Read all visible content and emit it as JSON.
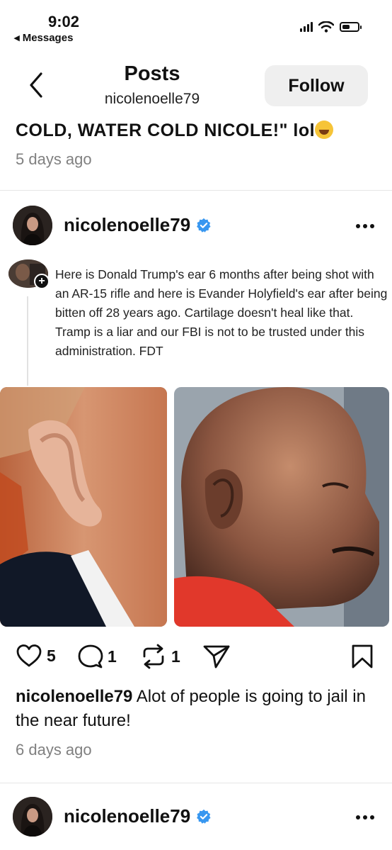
{
  "status_bar": {
    "time": "9:02",
    "back_app": "◂ Messages"
  },
  "header": {
    "title": "Posts",
    "subtitle": "nicolenoelle79",
    "follow_label": "Follow"
  },
  "previous_post": {
    "caption": "COLD, WATER COLD NICOLE!\" lol",
    "timestamp": "5 days ago"
  },
  "post": {
    "username": "nicolenoelle79",
    "embedded_text": "Here is Donald Trump's ear 6 months after being shot with an AR-15 rifle and here is Evander Holyfield's ear after being bitten off 28 years ago. Cartilage doesn't heal like that. Tramp is a liar and our FBI is not to be trusted under this administration. FDT",
    "likes": "5",
    "comments": "1",
    "reposts": "1",
    "caption_user": "nicolenoelle79",
    "caption_text": " Alot of people is going to jail in the near future!",
    "timestamp": "6 days ago"
  },
  "next_post": {
    "username": "nicolenoelle79"
  },
  "icons": {
    "back": "chevron-left-icon",
    "verified": "verified-badge-icon",
    "more": "more-icon",
    "like": "heart-icon",
    "comment": "comment-icon",
    "repost": "repost-icon",
    "share": "send-icon",
    "save": "bookmark-icon"
  },
  "colors": {
    "verified": "#3897f0",
    "timestamp": "#808080",
    "follow_bg": "#efefef"
  }
}
